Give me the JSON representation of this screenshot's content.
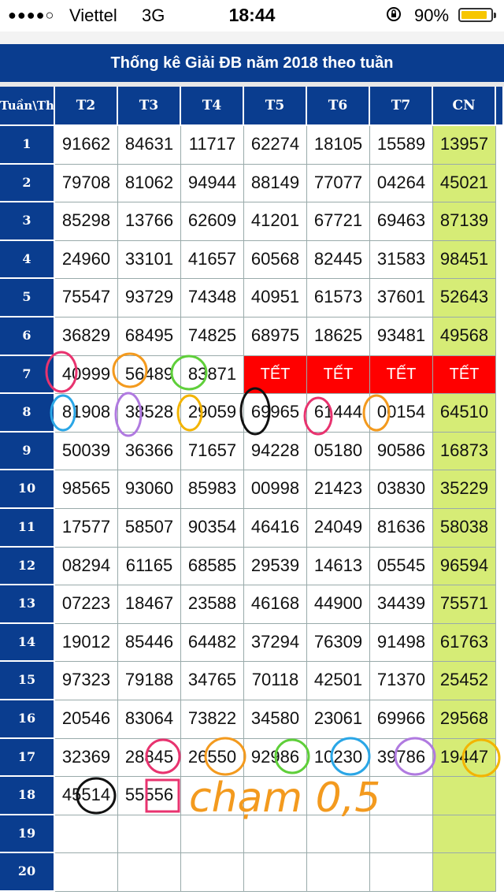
{
  "status_bar": {
    "signal": "●●●●○",
    "carrier": "Viettel",
    "network": "3G",
    "time": "18:44",
    "battery_percent": "90%",
    "battery_level": 0.9
  },
  "page_title": "Thống kê Giải ĐB năm 2018 theo tuần",
  "table": {
    "corner_label": "Tuần\\Thứ",
    "columns": [
      "T2",
      "T3",
      "T4",
      "T5",
      "T6",
      "T7",
      "CN"
    ],
    "rows": [
      {
        "week": "1",
        "values": [
          "91662",
          "84631",
          "11717",
          "62274",
          "18105",
          "15589",
          "13957"
        ]
      },
      {
        "week": "2",
        "values": [
          "79708",
          "81062",
          "94944",
          "88149",
          "77077",
          "04264",
          "45021"
        ]
      },
      {
        "week": "3",
        "values": [
          "85298",
          "13766",
          "62609",
          "41201",
          "67721",
          "69463",
          "87139"
        ]
      },
      {
        "week": "4",
        "values": [
          "24960",
          "33101",
          "41657",
          "60568",
          "82445",
          "31583",
          "98451"
        ]
      },
      {
        "week": "5",
        "values": [
          "75547",
          "93729",
          "74348",
          "40951",
          "61573",
          "37601",
          "52643"
        ]
      },
      {
        "week": "6",
        "values": [
          "36829",
          "68495",
          "74825",
          "68975",
          "18625",
          "93481",
          "49568"
        ]
      },
      {
        "week": "7",
        "values": [
          "40999",
          "56489",
          "83871",
          "TẾT",
          "TẾT",
          "TẾT",
          "TẾT"
        ]
      },
      {
        "week": "8",
        "values": [
          "81908",
          "38528",
          "29059",
          "69965",
          "61444",
          "00154",
          "64510"
        ]
      },
      {
        "week": "9",
        "values": [
          "50039",
          "36366",
          "71657",
          "94228",
          "05180",
          "90586",
          "16873"
        ]
      },
      {
        "week": "10",
        "values": [
          "98565",
          "93060",
          "85983",
          "00998",
          "21423",
          "03830",
          "35229"
        ]
      },
      {
        "week": "11",
        "values": [
          "17577",
          "58507",
          "90354",
          "46416",
          "24049",
          "81636",
          "58038"
        ]
      },
      {
        "week": "12",
        "values": [
          "08294",
          "61165",
          "68585",
          "29539",
          "14613",
          "05545",
          "96594"
        ]
      },
      {
        "week": "13",
        "values": [
          "07223",
          "18467",
          "23588",
          "46168",
          "44900",
          "34439",
          "75571"
        ]
      },
      {
        "week": "14",
        "values": [
          "19012",
          "85446",
          "64482",
          "37294",
          "76309",
          "91498",
          "61763"
        ]
      },
      {
        "week": "15",
        "values": [
          "97323",
          "79188",
          "34765",
          "70118",
          "42501",
          "71370",
          "25452"
        ]
      },
      {
        "week": "16",
        "values": [
          "20546",
          "83064",
          "73822",
          "34580",
          "23061",
          "69966",
          "29568"
        ]
      },
      {
        "week": "17",
        "values": [
          "32369",
          "28845",
          "26550",
          "92986",
          "10230",
          "39786",
          "19447"
        ]
      },
      {
        "week": "18",
        "values": [
          "45514",
          "55556",
          "",
          "",
          "",
          "",
          ""
        ]
      },
      {
        "week": "19",
        "values": [
          "",
          "",
          "",
          "",
          "",
          "",
          ""
        ]
      },
      {
        "week": "20",
        "values": [
          "",
          "",
          "",
          "",
          "",
          "",
          ""
        ]
      }
    ]
  },
  "annotation": {
    "handwritten_text": "chạm 0,5",
    "colors": {
      "pink": "#e8336f",
      "orange": "#f39a1e",
      "green": "#5fcf3a",
      "blue": "#2aa6e6",
      "purple": "#b07ae0",
      "black": "#111111",
      "yellow": "#f3b400"
    }
  },
  "colors": {
    "header_blue": "#0a3d8f",
    "cn_green": "#d6ec76",
    "tet_red": "#ff0000"
  }
}
